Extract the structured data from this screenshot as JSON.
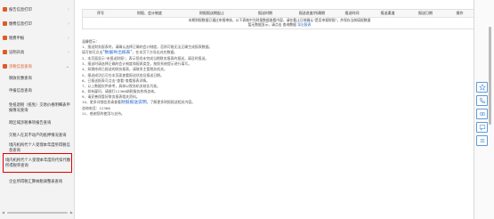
{
  "sidebar": {
    "items": [
      {
        "label": "报告信息打印",
        "chevron": "›"
      },
      {
        "label": "缴费信息打印",
        "chevron": "›"
      },
      {
        "label": "税费申报",
        "chevron": "›"
      },
      {
        "label": "证明开具",
        "chevron": "›"
      },
      {
        "label": "涉税信息查询",
        "chevron": "⌄"
      }
    ],
    "subitems": [
      "税收优惠查询",
      "申报信息查询",
      "免抵退税（抵免）交易价格明细表申报情况查询",
      "跨区域涉税事项报告查询",
      "欠税人在其不动产的抵押情况查询",
      "境内机构代个人受理本年度所得税信息查询",
      "境内机构代个人受理本年度的代扣代缴所得税单查询",
      "企业所得税汇算纳税调整表查询"
    ]
  },
  "table": {
    "headers": [
      "序号",
      "财报、会计制度",
      "财报报送期起止",
      "报送时期",
      "报送进度/所属期",
      "报送时间",
      "报送渠道",
      "报送日期",
      "操作"
    ],
    "note_line1": "本期财报数据已通过申报审核，以下表格中为财报数据查看内容，请在截止日前确认\"是否申报财报\"，并保存当前填报数据",
    "note_line2": "暂无数据显示，请点击 查询数据",
    "note_link": "导出报表"
  },
  "notes": {
    "heading": "温馨提示：",
    "lines": [
      "1、报送财务报表时，请确认选择正确的会计制度，否则可能无法正确生成报表数据。",
      "填写前可点击",
      "2、本页面显示\"未报送财报\"，表示您尚未完成当期财务报表的报送，请及时报送。",
      "3、报送时请选择正确的会计制度和报表类型，按照系统提示进行填写。",
      "4、如需修改已报送的财务报表，请联系主管税务机关。",
      "5、报送成功后可在本页面查看报送状态及报送日期。",
      "6、已报送报表可点击\"查看\"查看报表详情。",
      "7、以上数据仅供参考，具体以税务机关核实为准。",
      "8、如有疑问，请拨打12366纳税服务热线咨询。",
      "9、请妥善保管好财务报表相关资料。",
      "10、更多详细信息请查看",
      "咨询电话：12366",
      "11、感谢您的使用与支持。"
    ],
    "highlight1": "\"数据导出报表\"",
    "highlight1_suffix": "，在本页下方导出对应数据。",
    "highlight2": "财报报送说明",
    "highlight2_suffix": "，了解更多财报报送相关内容。"
  },
  "rightbar": {
    "icons": [
      "star-icon",
      "phone-icon",
      "link-icon",
      "message-icon",
      "list-icon"
    ]
  }
}
